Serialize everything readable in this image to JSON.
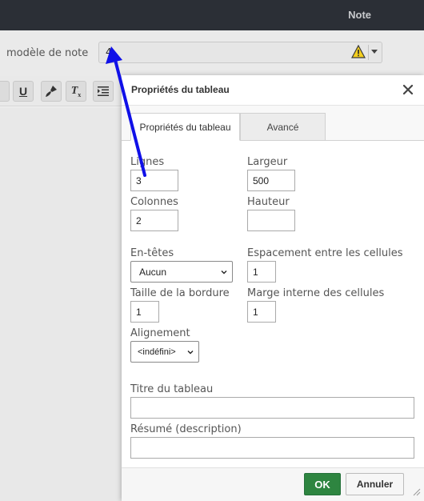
{
  "app": {
    "title": "Note"
  },
  "form": {
    "label": "modèle de note",
    "value": "4"
  },
  "dialog": {
    "title": "Propriétés du tableau",
    "tabs": [
      "Propriétés du tableau",
      "Avancé"
    ],
    "fields": {
      "rows_label": "Lignes",
      "rows_value": "3",
      "cols_label": "Colonnes",
      "cols_value": "2",
      "width_label": "Largeur",
      "width_value": "500",
      "height_label": "Hauteur",
      "height_value": "",
      "headers_label": "En-têtes",
      "headers_value": "Aucun",
      "spacing_label": "Espacement entre les cellules",
      "spacing_value": "1",
      "border_label": "Taille de la bordure",
      "border_value": "1",
      "padding_label": "Marge interne des cellules",
      "padding_value": "1",
      "align_label": "Alignement",
      "align_value": "<indéfini>",
      "caption_label": "Titre du tableau",
      "caption_value": "",
      "summary_label": "Résumé (description)",
      "summary_value": ""
    },
    "ok_label": "OK",
    "cancel_label": "Annuler"
  },
  "colors": {
    "ok_button": "#2e8540",
    "arrow": "#1010e8",
    "topbar": "#2b2f36"
  }
}
